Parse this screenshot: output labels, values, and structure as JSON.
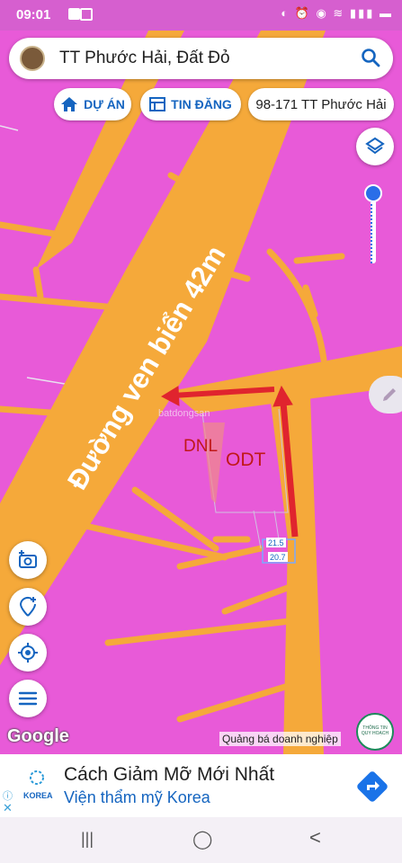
{
  "status_bar": {
    "time": "09:01",
    "right_icons": "◐ ⏰ ◉ ≋ ▮▮▮ ▬"
  },
  "search": {
    "text": "TT Phước Hải, Đất Đỏ"
  },
  "chips": [
    {
      "label": "DỰ ÁN",
      "icon": "home-icon"
    },
    {
      "label": "TIN ĐĂNG",
      "icon": "listing-icon"
    },
    {
      "label": "98-171 TT Phước Hải",
      "icon": ""
    }
  ],
  "map": {
    "road_label": "Đường ven biển 42m",
    "zone_labels": [
      "DNL",
      "ODT"
    ],
    "watermark": "batdongsan",
    "dimensions": [
      "21.5",
      "20.7"
    ],
    "colors": {
      "zone_fill": "#e85ad8",
      "road_fill": "#f5a93a",
      "arrow": "#e0242e",
      "accent": "#2a6ee8"
    }
  },
  "footer": {
    "google": "Google",
    "promo": "Quảng bá doanh nghiệp",
    "badge": "THÔNG TIN QUY HOẠCH"
  },
  "ad": {
    "title": "Cách Giảm Mỡ Mới Nhất",
    "subtitle": "Viện thẩm mỹ Korea",
    "logo_text": "KOREA"
  },
  "nav": {
    "recent": "|||",
    "home": "◯",
    "back": "<"
  }
}
